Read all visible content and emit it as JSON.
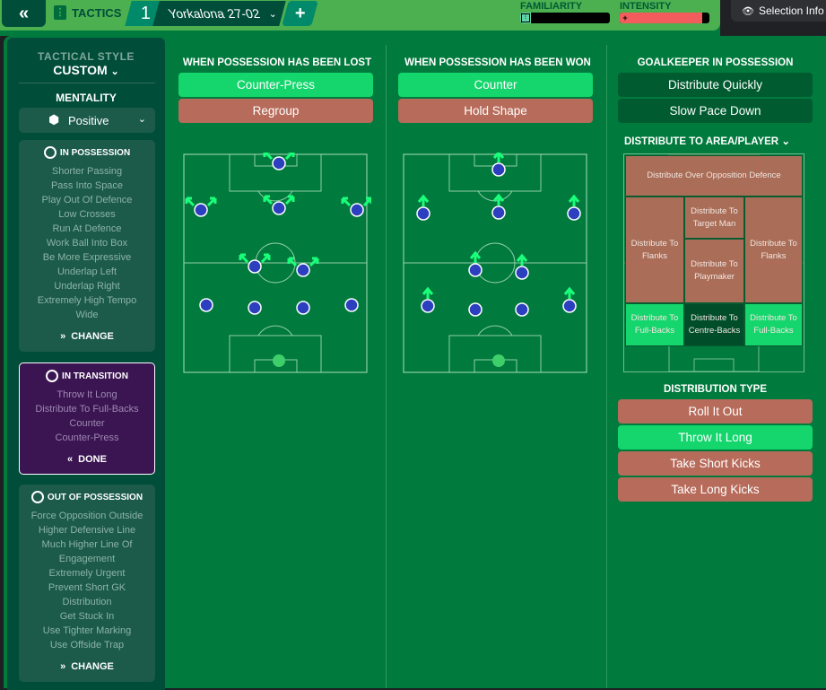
{
  "topbar": {
    "back_icon": "double-chevron-left",
    "section_icon": "tactics-board-icon",
    "section_label": "TACTICS",
    "tactic_slot": "1",
    "tactic_name": "Yorkalona 27-02",
    "add_label": "+",
    "familiarity": {
      "label": "FAMILIARITY",
      "value": 0.12,
      "color": "#5fd4a8"
    },
    "intensity": {
      "label": "INTENSITY",
      "value": 0.92,
      "color": "#f25c5c"
    },
    "selection_info": "Selection Info"
  },
  "sidebar": {
    "tactical_style_label": "TACTICAL STYLE",
    "tactical_style_value": "CUSTOM",
    "mentality_label": "MENTALITY",
    "mentality_value": "Positive",
    "in_possession": {
      "title": "IN POSSESSION",
      "items": [
        "Shorter Passing",
        "Pass Into Space",
        "Play Out Of Defence",
        "Low Crosses",
        "Run At Defence",
        "Work Ball Into Box",
        "Be More Expressive",
        "Underlap Left",
        "Underlap Right",
        "Extremely High Tempo",
        "Wide"
      ],
      "button": "CHANGE"
    },
    "in_transition": {
      "title": "IN TRANSITION",
      "items": [
        "Throw It Long",
        "Distribute To Full-Backs",
        "Counter",
        "Counter-Press"
      ],
      "button": "DONE"
    },
    "out_of_possession": {
      "title": "OUT OF POSSESSION",
      "items": [
        "Force Opposition Outside",
        "Higher Defensive Line",
        "Much Higher Line Of",
        "Engagement",
        "Extremely Urgent",
        "Prevent Short GK",
        "Distribution",
        "Get Stuck In",
        "Use Tighter Marking",
        "Use Offside Trap"
      ],
      "button": "CHANGE"
    }
  },
  "lost": {
    "title": "WHEN POSSESSION HAS BEEN LOST",
    "options": [
      {
        "label": "Counter-Press",
        "selected": true
      },
      {
        "label": "Regroup",
        "selected": false
      }
    ]
  },
  "won": {
    "title": "WHEN POSSESSION HAS BEEN WON",
    "options": [
      {
        "label": "Counter",
        "selected": true
      },
      {
        "label": "Hold Shape",
        "selected": false
      }
    ]
  },
  "goalkeeper": {
    "title": "GOALKEEPER IN POSSESSION",
    "options": [
      {
        "label": "Distribute Quickly"
      },
      {
        "label": "Slow Pace Down"
      }
    ],
    "area_title": "DISTRIBUTE TO AREA/PLAYER",
    "zones": {
      "over_defence": "Distribute Over Opposition Defence",
      "flanks_left": "Distribute To Flanks",
      "target_man": "Distribute To Target Man",
      "flanks_right": "Distribute To Flanks",
      "playmaker": "Distribute To Playmaker",
      "fullbacks_left": "Distribute To Full-Backs",
      "centrebacks": "Distribute To Centre-Backs",
      "fullbacks_right": "Distribute To Full-Backs"
    },
    "type_title": "DISTRIBUTION TYPE",
    "types": [
      {
        "label": "Roll It Out",
        "selected": false
      },
      {
        "label": "Throw It Long",
        "selected": true
      },
      {
        "label": "Take Short Kicks",
        "selected": false
      },
      {
        "label": "Take Long Kicks",
        "selected": false
      }
    ]
  },
  "colors": {
    "selected": "#14d66c",
    "unselected": "#b76b5a",
    "player": "#2b3fbf",
    "arrow": "#1aff7a",
    "keeper": "#3ecf6a"
  }
}
